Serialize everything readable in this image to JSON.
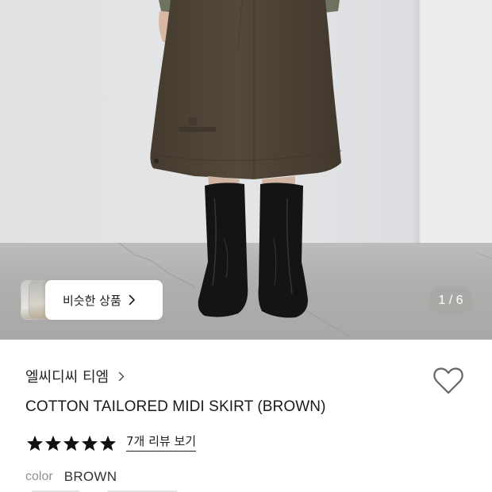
{
  "gallery": {
    "counter_text": "1 / 6",
    "similar_products_label": "비슷한 상품",
    "image_subject": "model wearing brown cotton midi skirt with black ankle boots"
  },
  "product": {
    "brand_name": "엘씨디씨 티엠",
    "title": "COTTON TAILORED MIDI SKIRT (BROWN)",
    "rating_stars": 5,
    "review_link": "7개 리뷰 보기",
    "color_label": "color",
    "color_value": "BROWN"
  },
  "icons": {
    "wishlist": "heart-outline-icon",
    "brand_chevron": "chevron-right-icon",
    "similar_chevron": "chevron-right-icon",
    "star": "star-filled-icon"
  },
  "colors": {
    "star_fill": "#111111",
    "skirt_brown": "#54483a",
    "text_muted": "#8f8f8f"
  }
}
